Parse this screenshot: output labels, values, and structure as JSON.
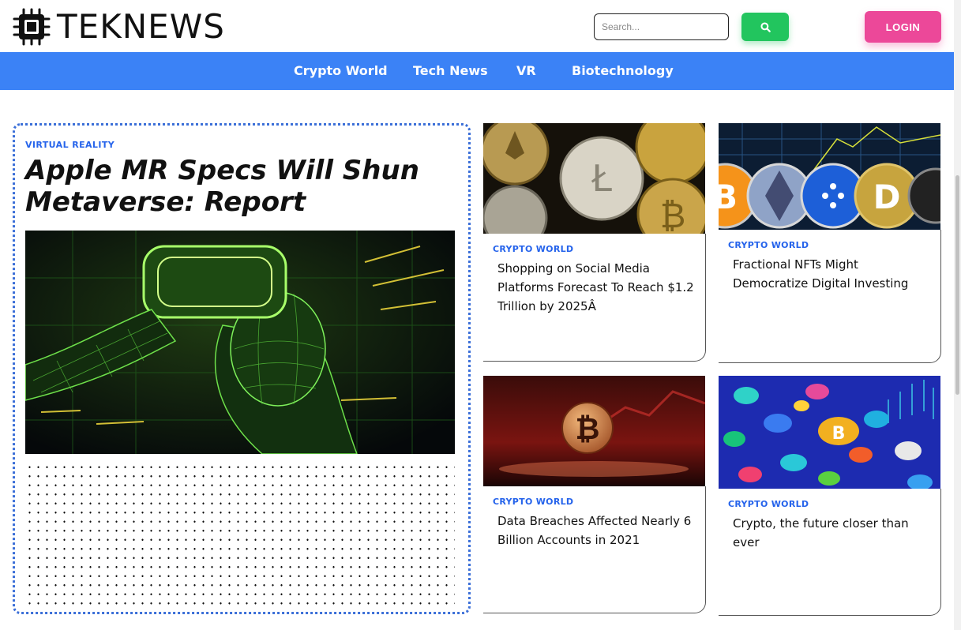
{
  "header": {
    "logo_text": "TEKNEWS",
    "search_placeholder": "Search...",
    "login_label": "LOGIN"
  },
  "nav": {
    "items": [
      {
        "label": "Crypto World"
      },
      {
        "label": "Tech News"
      },
      {
        "label": "VR"
      },
      {
        "label": "Biotechnology"
      }
    ]
  },
  "featured": {
    "category": "VIRTUAL REALITY",
    "title": "Apple MR Specs Will Shun Metaverse: Report"
  },
  "cards": [
    {
      "category": "CRYPTO WORLD",
      "title": "Shopping on Social Media Platforms Forecast To Reach $1.2 Trillion by 2025Â"
    },
    {
      "category": "CRYPTO WORLD",
      "title": "Fractional NFTs Might Democratize Digital Investing"
    },
    {
      "category": "CRYPTO WORLD",
      "title": "Data Breaches Affected Nearly 6 Billion Accounts in 2021"
    },
    {
      "category": "CRYPTO WORLD",
      "title": "Crypto, the future closer than ever"
    }
  ],
  "colors": {
    "nav_bg": "#3b82f6",
    "search_button": "#22c55e",
    "login_button": "#ec4899",
    "category_text": "#2563eb"
  },
  "icons": {
    "logo": "chip-icon",
    "search": "search-icon"
  }
}
